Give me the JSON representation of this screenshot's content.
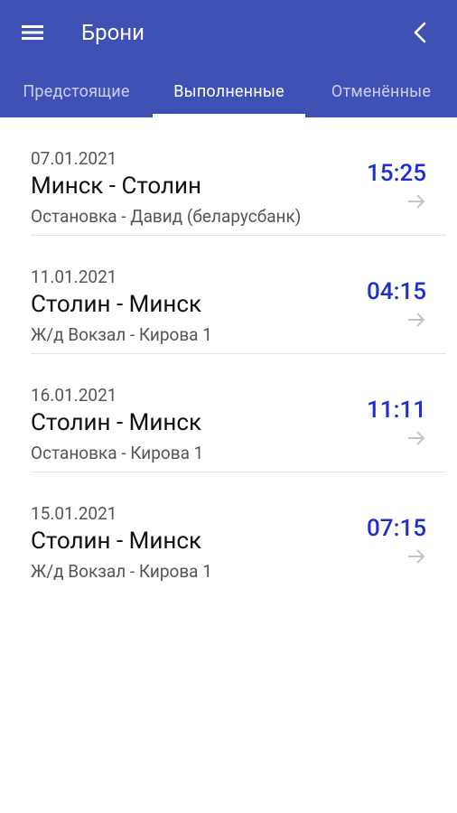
{
  "header": {
    "title": "Брони"
  },
  "tabs": [
    {
      "label": "Предстоящие"
    },
    {
      "label": "Выполненные"
    },
    {
      "label": "Отменённые"
    }
  ],
  "bookings": [
    {
      "date": "07.01.2021",
      "route": "Минск - Столин",
      "stops": "Остановка - Давид (беларусбанк)",
      "time": "15:25"
    },
    {
      "date": "11.01.2021",
      "route": "Столин - Минск",
      "stops": "Ж/д Вокзал - Кирова 1",
      "time": "04:15"
    },
    {
      "date": "16.01.2021",
      "route": "Столин - Минск",
      "stops": "Остановка - Кирова 1",
      "time": "11:11"
    },
    {
      "date": "15.01.2021",
      "route": "Столин - Минск",
      "stops": "Ж/д Вокзал - Кирова 1",
      "time": "07:15"
    }
  ],
  "colors": {
    "appbar": "#3F51B5",
    "time": "#1f2ecc",
    "arrow": "#c4c4c4"
  },
  "icons": {
    "menu": "menu-icon",
    "back": "chevron-left-icon",
    "row_arrow": "arrow-right-icon"
  }
}
